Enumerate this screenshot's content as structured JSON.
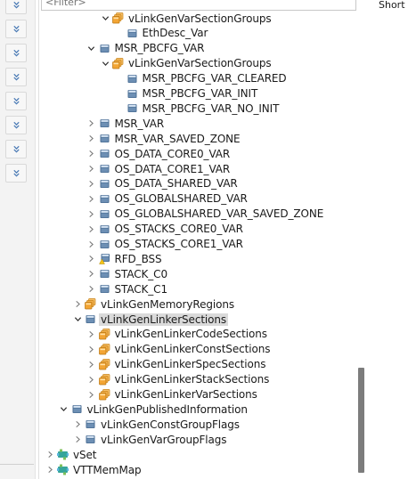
{
  "filter": {
    "placeholder": "<Filter>"
  },
  "right_panel": {
    "column_header": "Short"
  },
  "left_strip": {
    "button_count": 8,
    "button_icon": "double-chevron-down-icon"
  },
  "colors": {
    "container_icon": "#f3a534",
    "bsw_icon": "#4a6fa5",
    "warning_overlay": "#f5c518"
  },
  "tree": [
    {
      "label": "vLinkGenVarSectionGroups",
      "depth": 4,
      "expander": "expanded",
      "icon": "folder-stack-icon"
    },
    {
      "label": "EthDesc_Var",
      "depth": 5,
      "expander": "none",
      "icon": "element-icon"
    },
    {
      "label": "MSR_PBCFG_VAR",
      "depth": 3,
      "expander": "expanded",
      "icon": "element-icon"
    },
    {
      "label": "vLinkGenVarSectionGroups",
      "depth": 4,
      "expander": "expanded",
      "icon": "folder-stack-icon"
    },
    {
      "label": "MSR_PBCFG_VAR_CLEARED",
      "depth": 5,
      "expander": "none",
      "icon": "element-icon"
    },
    {
      "label": "MSR_PBCFG_VAR_INIT",
      "depth": 5,
      "expander": "none",
      "icon": "element-icon"
    },
    {
      "label": "MSR_PBCFG_VAR_NO_INIT",
      "depth": 5,
      "expander": "none",
      "icon": "element-icon"
    },
    {
      "label": "MSR_VAR",
      "depth": 3,
      "expander": "collapsed",
      "icon": "element-icon"
    },
    {
      "label": "MSR_VAR_SAVED_ZONE",
      "depth": 3,
      "expander": "collapsed",
      "icon": "element-icon"
    },
    {
      "label": "OS_DATA_CORE0_VAR",
      "depth": 3,
      "expander": "collapsed",
      "icon": "element-icon"
    },
    {
      "label": "OS_DATA_CORE1_VAR",
      "depth": 3,
      "expander": "collapsed",
      "icon": "element-icon"
    },
    {
      "label": "OS_DATA_SHARED_VAR",
      "depth": 3,
      "expander": "collapsed",
      "icon": "element-icon"
    },
    {
      "label": "OS_GLOBALSHARED_VAR",
      "depth": 3,
      "expander": "collapsed",
      "icon": "element-icon"
    },
    {
      "label": "OS_GLOBALSHARED_VAR_SAVED_ZONE",
      "depth": 3,
      "expander": "collapsed",
      "icon": "element-icon"
    },
    {
      "label": "OS_STACKS_CORE0_VAR",
      "depth": 3,
      "expander": "collapsed",
      "icon": "element-icon"
    },
    {
      "label": "OS_STACKS_CORE1_VAR",
      "depth": 3,
      "expander": "collapsed",
      "icon": "element-icon"
    },
    {
      "label": "RFD_BSS",
      "depth": 3,
      "expander": "collapsed",
      "icon": "element-warning-icon"
    },
    {
      "label": "STACK_C0",
      "depth": 3,
      "expander": "collapsed",
      "icon": "element-icon"
    },
    {
      "label": "STACK_C1",
      "depth": 3,
      "expander": "collapsed",
      "icon": "element-icon"
    },
    {
      "label": "vLinkGenMemoryRegions",
      "depth": 2,
      "expander": "collapsed",
      "icon": "folder-stack-icon"
    },
    {
      "label": "vLinkGenLinkerSections",
      "depth": 2,
      "expander": "expanded",
      "icon": "element-icon",
      "selected": true
    },
    {
      "label": "vLinkGenLinkerCodeSections",
      "depth": 3,
      "expander": "collapsed",
      "icon": "folder-stack-icon"
    },
    {
      "label": "vLinkGenLinkerConstSections",
      "depth": 3,
      "expander": "collapsed",
      "icon": "folder-stack-icon"
    },
    {
      "label": "vLinkGenLinkerSpecSections",
      "depth": 3,
      "expander": "collapsed",
      "icon": "folder-stack-icon"
    },
    {
      "label": "vLinkGenLinkerStackSections",
      "depth": 3,
      "expander": "collapsed",
      "icon": "folder-stack-icon"
    },
    {
      "label": "vLinkGenLinkerVarSections",
      "depth": 3,
      "expander": "collapsed",
      "icon": "folder-stack-icon"
    },
    {
      "label": "vLinkGenPublishedInformation",
      "depth": 1,
      "expander": "expanded",
      "icon": "element-icon"
    },
    {
      "label": "vLinkGenConstGroupFlags",
      "depth": 2,
      "expander": "collapsed",
      "icon": "element-icon"
    },
    {
      "label": "vLinkGenVarGroupFlags",
      "depth": 2,
      "expander": "collapsed",
      "icon": "element-icon"
    },
    {
      "label": "vSet",
      "depth": 0,
      "expander": "collapsed",
      "icon": "bsw-module-icon"
    },
    {
      "label": "VTTMemMap",
      "depth": 0,
      "expander": "collapsed",
      "icon": "bsw-module-icon"
    }
  ]
}
